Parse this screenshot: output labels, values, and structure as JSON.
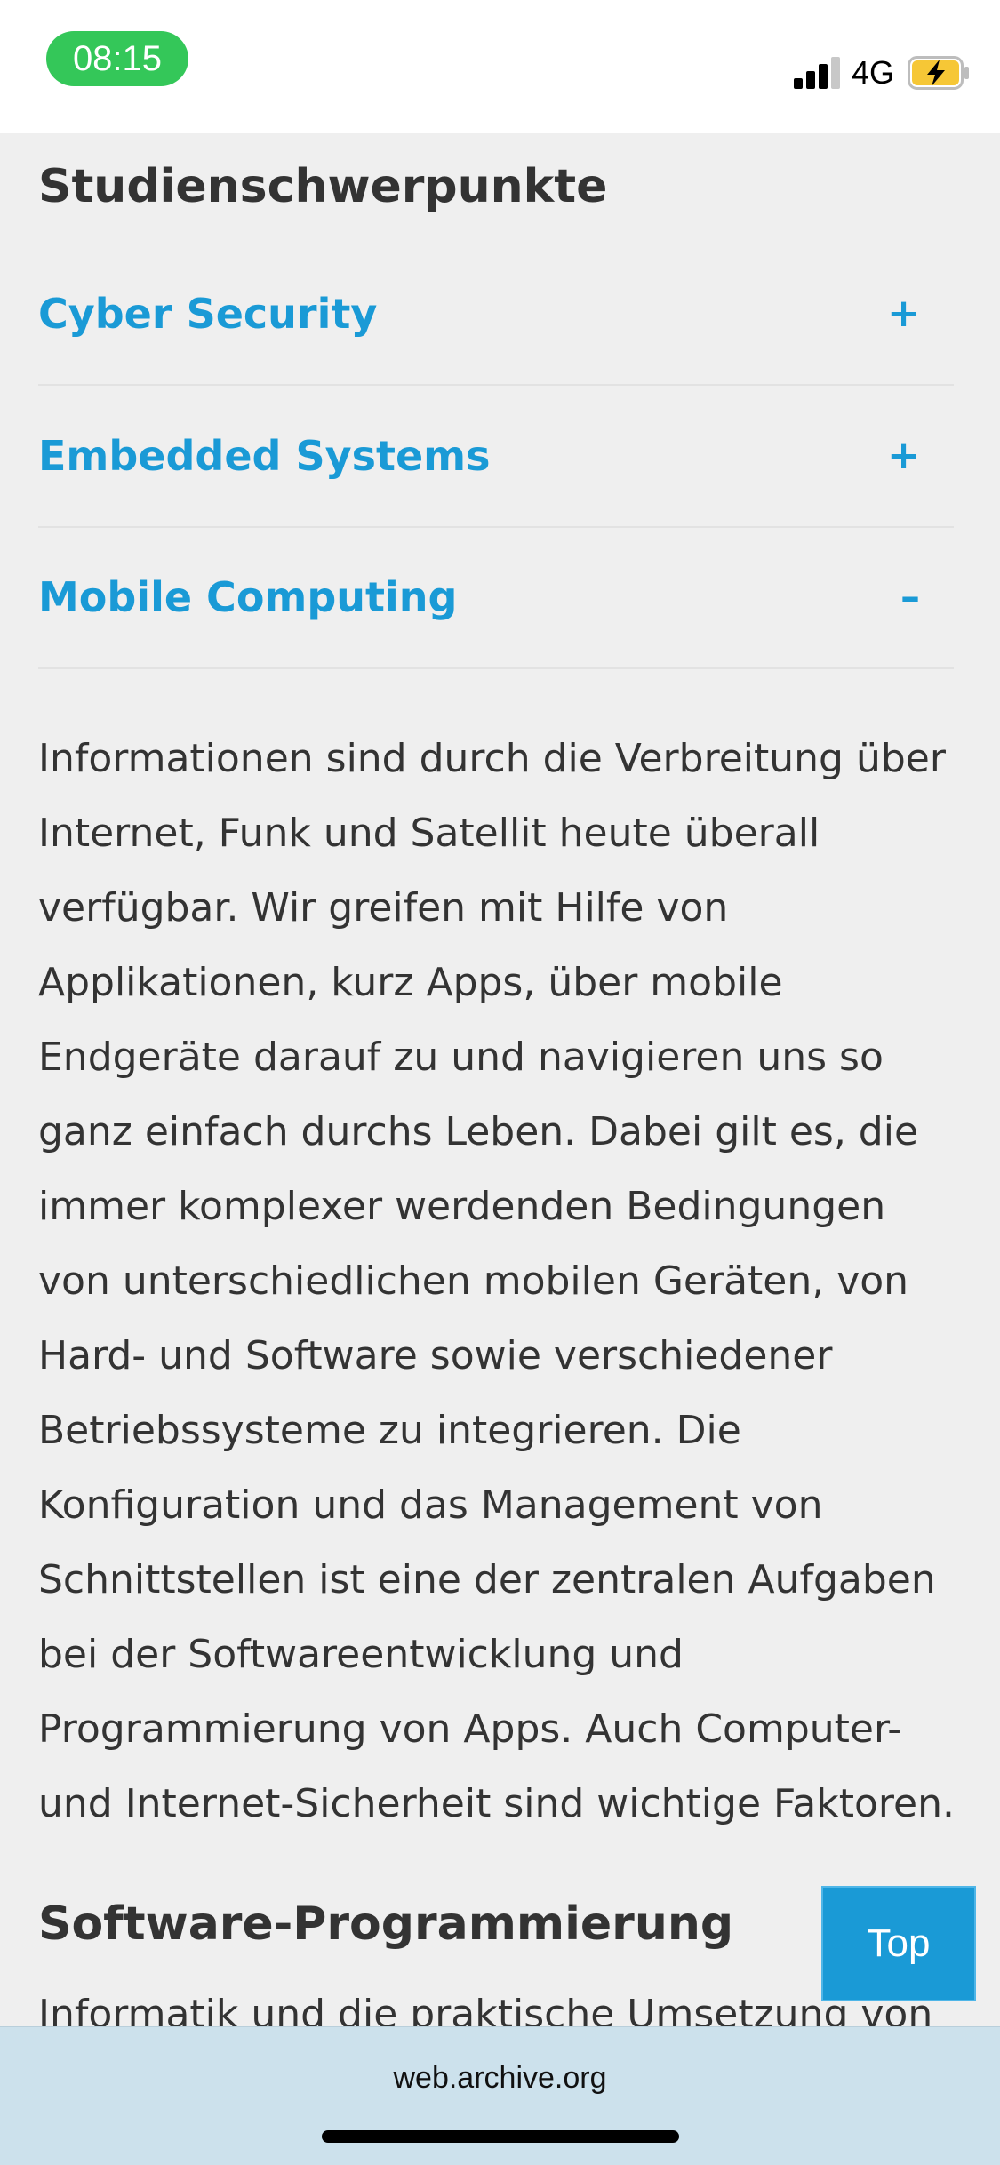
{
  "status_bar": {
    "time": "08:15",
    "network": "4G"
  },
  "page": {
    "section_title": "Studienschwerpunkte",
    "accordion": [
      {
        "label": "Cyber Security",
        "toggle": "+"
      },
      {
        "label": "Embedded Systems",
        "toggle": "+"
      },
      {
        "label": "Mobile Computing",
        "toggle": "–"
      }
    ],
    "mobile_computing_text": [
      "Informationen sind durch die Verbreitung über",
      "Internet, Funk und Satellit heute überall",
      "verfügbar. Wir greifen mit Hilfe von",
      "Applikationen, kurz Apps, über mobile",
      "Endgeräte darauf zu und navigieren uns so",
      "ganz einfach durchs Leben. Dabei gilt es, die",
      "immer komplexer werdenden Bedingungen",
      "von unterschiedlichen mobilen Geräten, von",
      "Hard- und Software sowie verschiedener",
      "Betriebssysteme zu integrieren. Die",
      "Konfiguration und das Management von",
      "Schnittstellen ist eine der zentralen Aufgaben",
      "bei der Softwareentwicklung und",
      "Programmierung von Apps. Auch Computer-",
      "und Internet-Sicherheit sind wichtige Faktoren."
    ],
    "next_section_title": "Software-Programmierung",
    "next_section_text": "Informatik und die praktische Umsetzung von",
    "top_button": "Top"
  },
  "browser": {
    "url": "web.archive.org"
  },
  "colors": {
    "accent": "#1a9ad6",
    "background": "#efefef",
    "text": "#333333",
    "browser_bar": "#cce1ec",
    "time_pill": "#34c759"
  }
}
